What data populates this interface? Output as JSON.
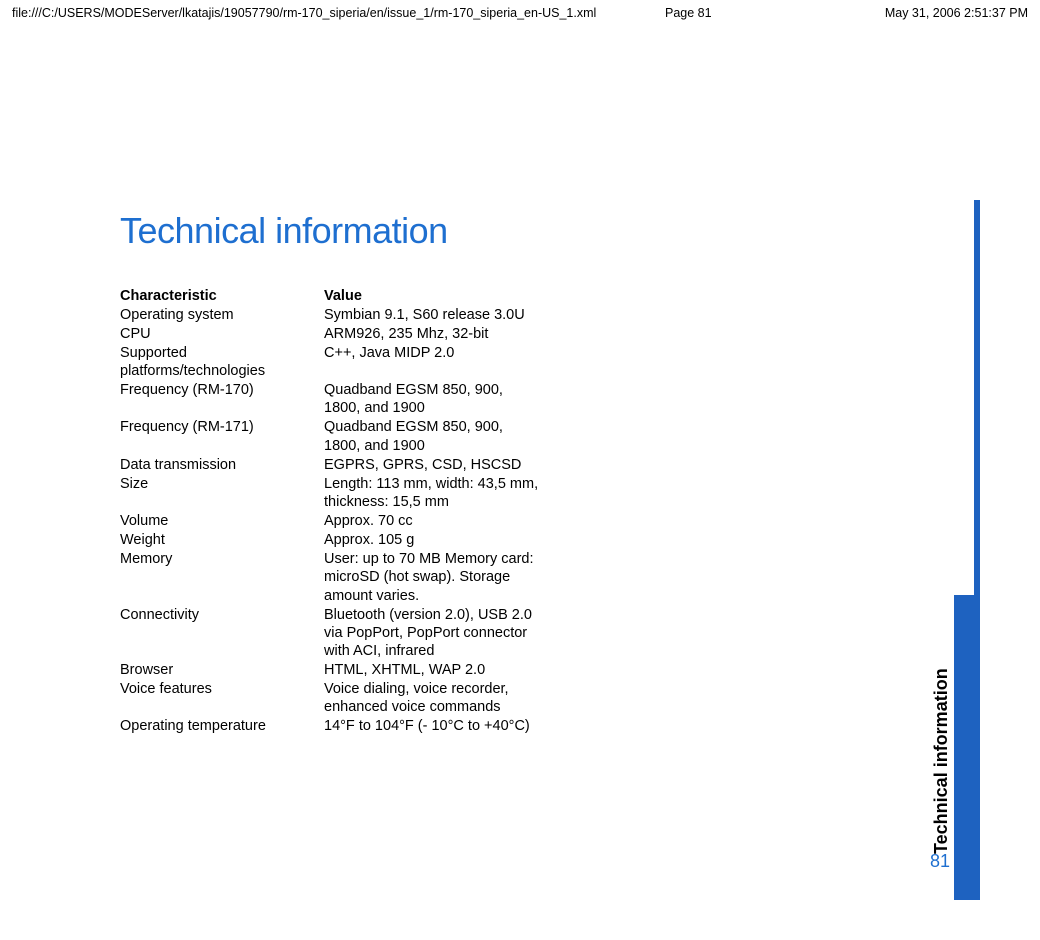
{
  "header": {
    "path": "file:///C:/USERS/MODEServer/lkatajis/19057790/rm-170_siperia/en/issue_1/rm-170_siperia_en-US_1.xml",
    "page": "Page 81",
    "date": "May 31, 2006 2:51:37 PM"
  },
  "title": "Technical information",
  "table_header": {
    "char": "Characteristic",
    "val": "Value"
  },
  "specs": [
    {
      "label": "Operating system",
      "value": "Symbian 9.1, S60 release 3.0U"
    },
    {
      "label": "CPU",
      "value": "ARM926, 235 Mhz, 32-bit"
    },
    {
      "label": "Supported platforms/technologies",
      "value": "C++, Java MIDP 2.0"
    },
    {
      "label": "Frequency (RM-170)",
      "value": "Quadband EGSM 850, 900, 1800, and 1900"
    },
    {
      "label": "Frequency (RM-171)",
      "value": "Quadband EGSM 850, 900, 1800, and 1900"
    },
    {
      "label": "Data transmission",
      "value": "EGPRS, GPRS, CSD, HSCSD"
    },
    {
      "label": "Size",
      "value": "Length: 113 mm, width: 43,5 mm, thickness: 15,5 mm"
    },
    {
      "label": "Volume",
      "value": "Approx. 70 cc"
    },
    {
      "label": "Weight",
      "value": "Approx. 105 g"
    },
    {
      "label": "Memory",
      "value": "User: up to 70 MB Memory card: microSD (hot swap). Storage amount varies."
    },
    {
      "label": "Connectivity",
      "value": "Bluetooth (version 2.0), USB 2.0 via PopPort, PopPort connector with ACI, infrared"
    },
    {
      "label": "Browser",
      "value": "HTML, XHTML, WAP 2.0"
    },
    {
      "label": "Voice features",
      "value": "Voice dialing, voice recorder, enhanced voice commands"
    },
    {
      "label": "Operating temperature",
      "value": "14°F to 104°F (- 10°C to +40°C)"
    }
  ],
  "side_label": "Technical information",
  "page_number": "81"
}
